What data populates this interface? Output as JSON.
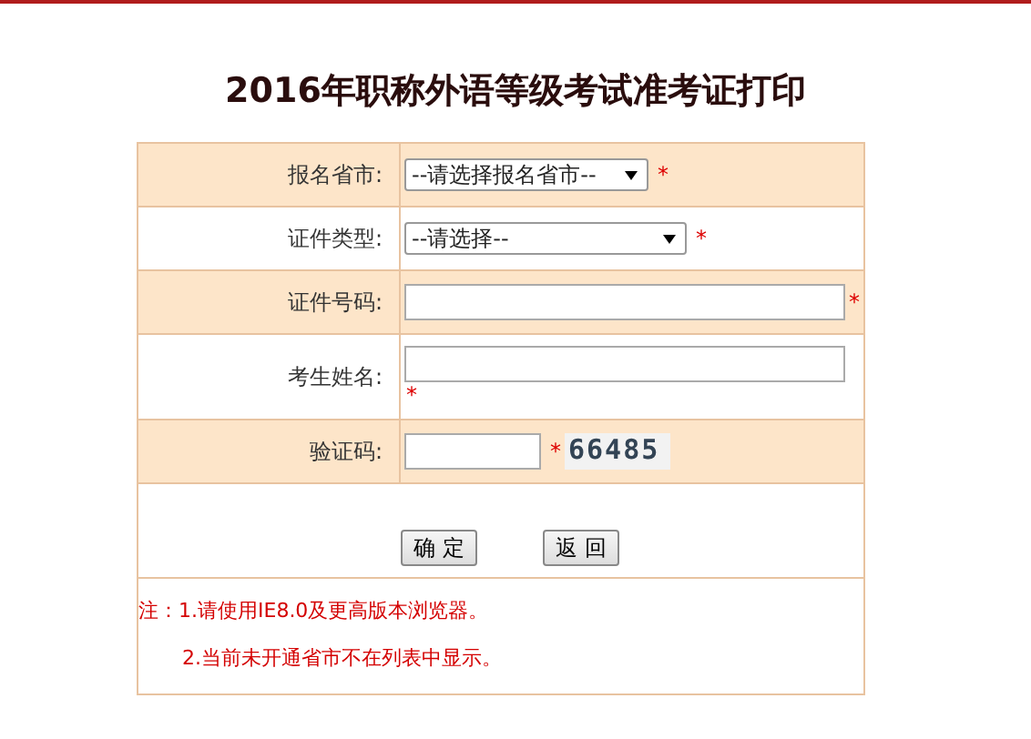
{
  "title": "2016年职称外语等级考试准考证打印",
  "fields": [
    {
      "label": "报名省市:",
      "kind": "select",
      "value": "--请选择报名省市--",
      "required_mark": "*"
    },
    {
      "label": "证件类型:",
      "kind": "select",
      "value": "--请选择--",
      "required_mark": "*"
    },
    {
      "label": "证件号码:",
      "kind": "text",
      "required_mark": "*"
    },
    {
      "label": "考生姓名:",
      "kind": "text",
      "required_mark": "*"
    },
    {
      "label": "验证码:",
      "kind": "captcha",
      "required_mark": "*",
      "code": "66485"
    }
  ],
  "buttons": [
    "确 定",
    "返 回"
  ],
  "notes": [
    "注：1.请使用IE8.0及更高版本浏览器。",
    "2.当前未开通省市不在列表中显示。"
  ]
}
